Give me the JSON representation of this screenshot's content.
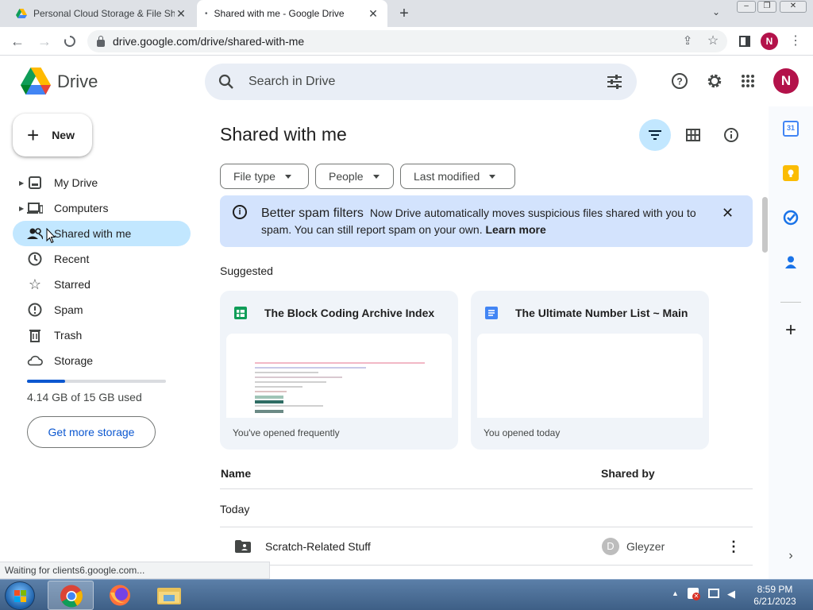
{
  "browser": {
    "tabs": [
      {
        "title": "Personal Cloud Storage & File Sh"
      },
      {
        "title": "Shared with me - Google Drive"
      }
    ],
    "new_tab": "+",
    "url": "drive.google.com/drive/shared-with-me",
    "profile_initial": "N",
    "status_text": "Waiting for clients6.google.com..."
  },
  "header": {
    "product_name": "Drive",
    "search_placeholder": "Search in Drive",
    "avatar_initial": "N"
  },
  "sidebar": {
    "new_label": "New",
    "items": [
      {
        "label": "My Drive"
      },
      {
        "label": "Computers"
      },
      {
        "label": "Shared with me"
      },
      {
        "label": "Recent"
      },
      {
        "label": "Starred"
      },
      {
        "label": "Spam"
      },
      {
        "label": "Trash"
      },
      {
        "label": "Storage"
      }
    ],
    "storage_used_fraction": 0.276,
    "storage_text": "4.14 GB of 15 GB used",
    "get_more_label": "Get more storage"
  },
  "main": {
    "title": "Shared with me",
    "filters": [
      "File type",
      "People",
      "Last modified"
    ],
    "banner": {
      "heading": "Better spam filters",
      "body": "Now Drive automatically moves suspicious files shared with you to spam. You can still report spam on your own.",
      "link": "Learn more"
    },
    "suggested_label": "Suggested",
    "cards": [
      {
        "title": "The Block Coding Archive Index",
        "reason": "You've opened frequently"
      },
      {
        "title": "The Ultimate Number List ~ Main",
        "reason": "You opened today"
      }
    ],
    "columns": {
      "name": "Name",
      "shared_by": "Shared by"
    },
    "group_label": "Today",
    "rows": [
      {
        "name": "Scratch-Related Stuff",
        "shared_by": "Gleyzer",
        "initial": "D"
      }
    ]
  },
  "taskbar": {
    "time": "8:59 PM",
    "date": "6/21/2023"
  },
  "colors": {
    "accent": "#0b57d0",
    "selected_nav": "#c2e7ff",
    "banner": "#d3e3fd",
    "search_bg": "#e9eef6",
    "avatar": "#b3124a"
  }
}
